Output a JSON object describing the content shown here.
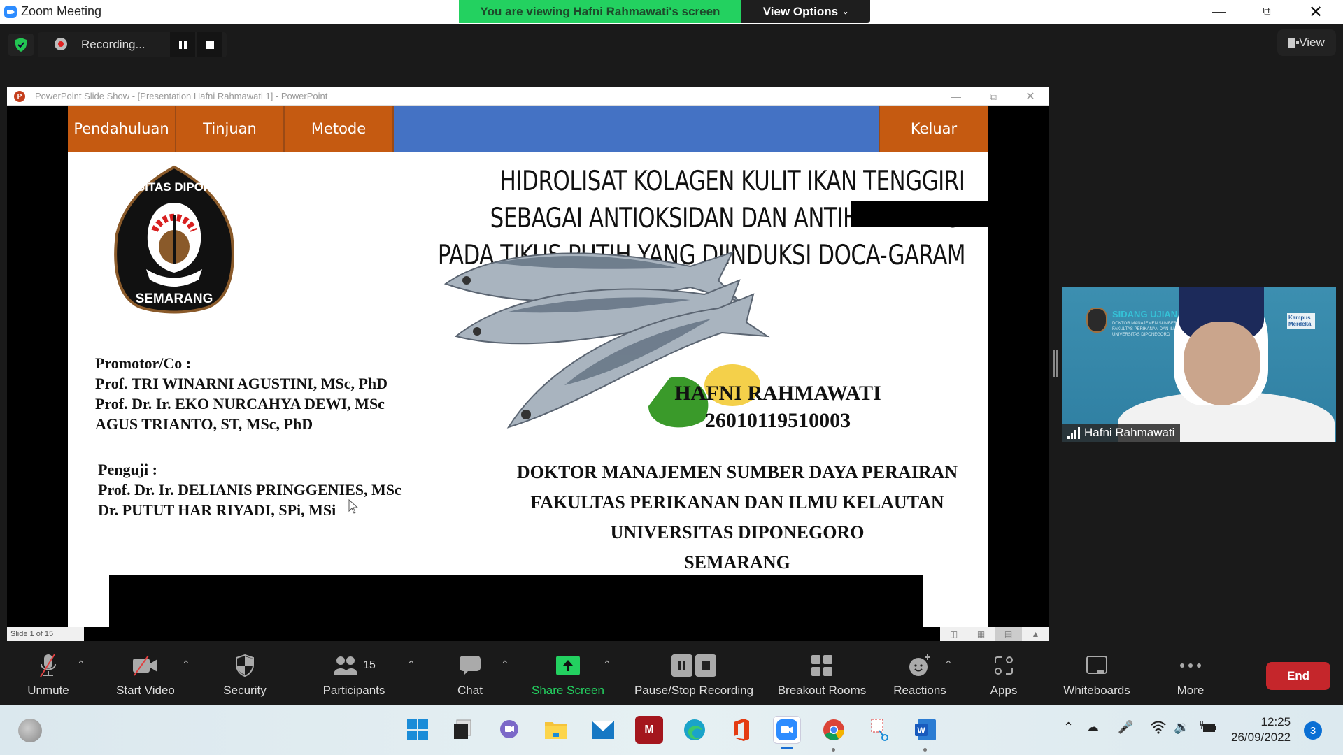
{
  "window": {
    "title": "Zoom Meeting",
    "viewing_banner": "You are viewing Hafni Rahmawati's screen",
    "view_options_label": "View Options",
    "view_label": "View",
    "recording_label": "Recording..."
  },
  "powerpoint": {
    "window_title": "PowerPoint Slide Show - [Presentation Hafni Rahmawati 1] - PowerPoint",
    "status_slide": "Slide 1 of 15",
    "nav": [
      "Pendahuluan",
      "Tinjuan",
      "Metode",
      "Keluar"
    ],
    "title_lines": [
      "HIDROLISAT KOLAGEN KULIT IKAN TENGGIRI",
      "SEBAGAI ANTIOKSIDAN DAN ANTIHIPERTENSI",
      "PADA TIKUS PUTIH YANG DIINDUKSI DOCA-GARAM"
    ],
    "logo_text_top": "UNIVERSITAS DIPONEGORO",
    "logo_text_bottom": "SEMARANG",
    "promotor_heading": "Promotor/Co :",
    "promotors": [
      "Prof. TRI WINARNI AGUSTINI, MSc, PhD",
      "Prof. Dr. Ir. EKO NURCAHYA DEWI, MSc",
      "AGUS TRIANTO, ST, MSc, PhD"
    ],
    "penguji_heading": "Penguji :",
    "pengujis": [
      "Prof. Dr. Ir. DELIANIS PRINGGENIES, MSc",
      "Dr. PUTUT HAR RIYADI, SPi, MSi"
    ],
    "student_name": "HAFNI RAHMAWATI",
    "student_id": "26010119510003",
    "institution_lines": [
      "DOKTOR MANAJEMEN SUMBER DAYA PERAIRAN",
      "FAKULTAS PERIKANAN DAN ILMU KELAUTAN",
      "UNIVERSITAS DIPONEGORO",
      "SEMARANG"
    ]
  },
  "video": {
    "participant_name": "Hafni Rahmawati",
    "background_title": "SIDANG UJIAN KO",
    "background_sub": [
      "DOKTOR MANAJEMEN SUMBERDA",
      "FAKULTAS PERIKANAN DAN ILMU",
      "UNIVERSITAS DIPONEGORO"
    ],
    "badge": "Kampus Merdeka"
  },
  "toolbar": {
    "unmute": "Unmute",
    "start_video": "Start Video",
    "security": "Security",
    "participants": "Participants",
    "participants_count": "15",
    "chat": "Chat",
    "share_screen": "Share Screen",
    "pause_stop_recording": "Pause/Stop Recording",
    "breakout_rooms": "Breakout Rooms",
    "reactions": "Reactions",
    "apps": "Apps",
    "whiteboards": "Whiteboards",
    "more": "More",
    "end": "End"
  },
  "colors": {
    "zoom_blue": "#2d8cff",
    "banner_green": "#23d160",
    "nav_orange": "#c55a11",
    "nav_blue": "#4472c4",
    "end_red": "#c5262b"
  },
  "taskbar": {
    "apps": [
      "start-icon",
      "task-view-icon",
      "teams-chat-icon",
      "file-explorer-icon",
      "mail-icon",
      "mendeley-icon",
      "edge-icon",
      "office-icon",
      "zoom-icon",
      "chrome-icon",
      "snipping-tool-icon",
      "word-icon"
    ],
    "time": "12:25",
    "date": "26/09/2022",
    "notification_count": "3"
  }
}
